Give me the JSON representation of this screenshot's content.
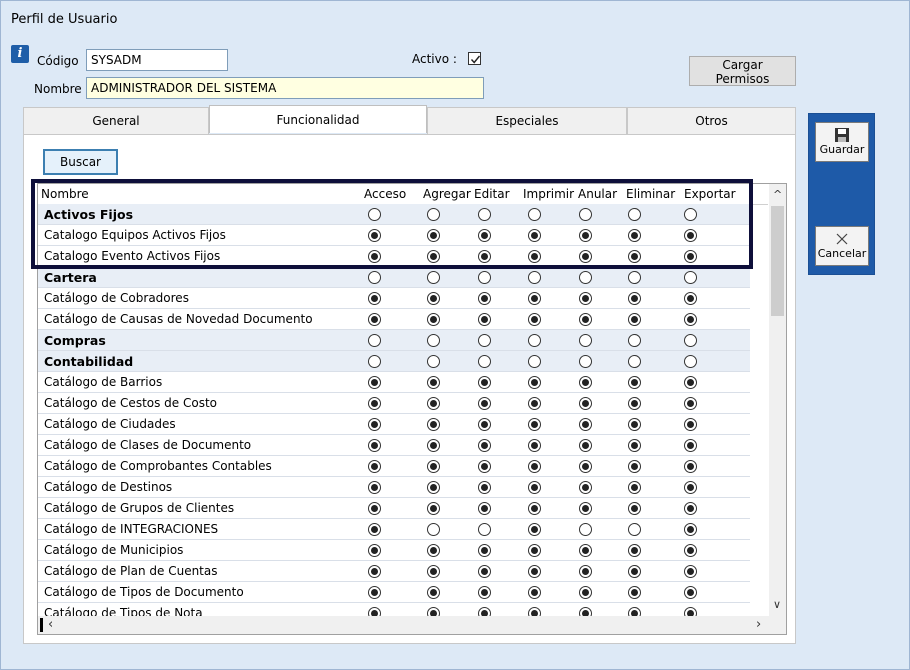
{
  "window": {
    "title": "Perfil de Usuario"
  },
  "header": {
    "codigo_label": "Código",
    "codigo_value": "SYSADM",
    "nombre_label": "Nombre",
    "nombre_value": "ADMINISTRADOR DEL SISTEMA",
    "activo_label": "Activo :",
    "activo_checked": true,
    "cargar_permisos": "Cargar Permisos"
  },
  "tabs": [
    {
      "label": "General",
      "active": false
    },
    {
      "label": "Funcionalidad",
      "active": true
    },
    {
      "label": "Especiales",
      "active": false
    },
    {
      "label": "Otros",
      "active": false
    }
  ],
  "toolbar": {
    "buscar": "Buscar"
  },
  "side_buttons": {
    "guardar": "Guardar",
    "cancelar": "Cancelar"
  },
  "grid": {
    "columns": [
      "Nombre",
      "Acceso",
      "Agregar",
      "Editar",
      "Imprimir",
      "Anular",
      "Eliminar",
      "Exportar"
    ],
    "rows": [
      {
        "name": "Activos Fijos",
        "group": true,
        "perms": [
          0,
          0,
          0,
          0,
          0,
          0,
          0
        ]
      },
      {
        "name": "Catalogo Equipos Activos Fijos",
        "group": false,
        "perms": [
          1,
          1,
          1,
          1,
          1,
          1,
          1
        ]
      },
      {
        "name": "Catalogo Evento Activos Fijos",
        "group": false,
        "perms": [
          1,
          1,
          1,
          1,
          1,
          1,
          1
        ]
      },
      {
        "name": "Cartera",
        "group": true,
        "perms": [
          0,
          0,
          0,
          0,
          0,
          0,
          0
        ]
      },
      {
        "name": "Catálogo de Cobradores",
        "group": false,
        "perms": [
          1,
          1,
          1,
          1,
          1,
          1,
          1
        ]
      },
      {
        "name": "Catálogo de Causas de Novedad Documento",
        "group": false,
        "perms": [
          1,
          1,
          1,
          1,
          1,
          1,
          1
        ]
      },
      {
        "name": "Compras",
        "group": true,
        "perms": [
          0,
          0,
          0,
          0,
          0,
          0,
          0
        ]
      },
      {
        "name": "Contabilidad",
        "group": true,
        "perms": [
          0,
          0,
          0,
          0,
          0,
          0,
          0
        ]
      },
      {
        "name": "Catálogo de Barrios",
        "group": false,
        "perms": [
          1,
          1,
          1,
          1,
          1,
          1,
          1
        ]
      },
      {
        "name": "Catálogo de Cestos de Costo",
        "group": false,
        "perms": [
          1,
          1,
          1,
          1,
          1,
          1,
          1
        ]
      },
      {
        "name": "Catálogo de Ciudades",
        "group": false,
        "perms": [
          1,
          1,
          1,
          1,
          1,
          1,
          1
        ]
      },
      {
        "name": "Catálogo de Clases de Documento",
        "group": false,
        "perms": [
          1,
          1,
          1,
          1,
          1,
          1,
          1
        ]
      },
      {
        "name": "Catálogo de Comprobantes Contables",
        "group": false,
        "perms": [
          1,
          1,
          1,
          1,
          1,
          1,
          1
        ]
      },
      {
        "name": "Catálogo de Destinos",
        "group": false,
        "perms": [
          1,
          1,
          1,
          1,
          1,
          1,
          1
        ]
      },
      {
        "name": "Catálogo de Grupos de Clientes",
        "group": false,
        "perms": [
          1,
          1,
          1,
          1,
          1,
          1,
          1
        ]
      },
      {
        "name": "Catálogo de INTEGRACIONES",
        "group": false,
        "perms": [
          1,
          0,
          0,
          1,
          0,
          0,
          1
        ]
      },
      {
        "name": "Catálogo de Municipios",
        "group": false,
        "perms": [
          1,
          1,
          1,
          1,
          1,
          1,
          1
        ]
      },
      {
        "name": "Catálogo de Plan de Cuentas",
        "group": false,
        "perms": [
          1,
          1,
          1,
          1,
          1,
          1,
          1
        ]
      },
      {
        "name": "Catálogo de Tipos de Documento",
        "group": false,
        "perms": [
          1,
          1,
          1,
          1,
          1,
          1,
          1
        ]
      },
      {
        "name": "Catálogo de Tipos de Nota",
        "group": false,
        "perms": [
          1,
          1,
          1,
          1,
          1,
          1,
          1
        ]
      }
    ]
  }
}
